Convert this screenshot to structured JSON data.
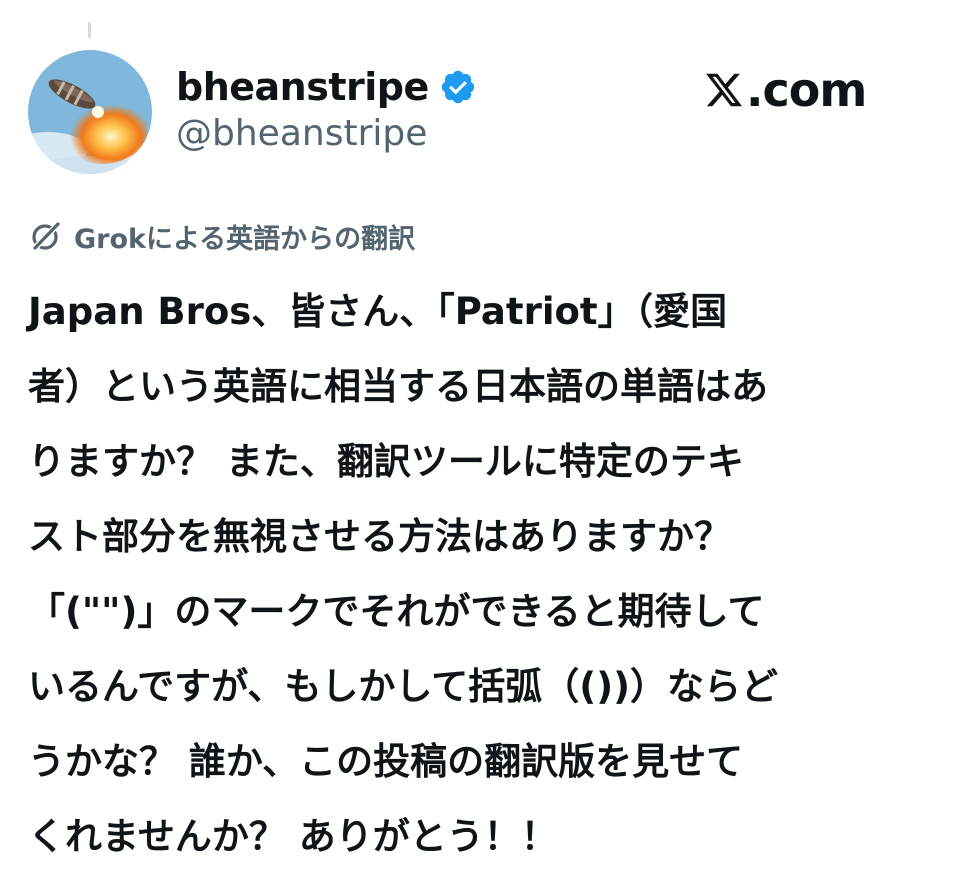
{
  "post": {
    "author": {
      "display_name": "bheanstripe",
      "handle": "@bheanstripe",
      "verified_icon": "verified-badge-icon",
      "avatar": "avatar-image"
    },
    "brand": {
      "text": ".com",
      "icon": "x-logo-icon"
    },
    "translation": {
      "icon": "grok-icon",
      "label": "Grokによる英語からの翻訳"
    },
    "text_lines": [
      "Japan Bros、皆さん、「Patriot」（愛国",
      "者）という英語に相当する日本語の単語はあ",
      "りますか？ また、翻訳ツールに特定のテキ",
      "スト部分を無視させる方法はありますか？",
      "「(\"\")」のマークでそれができると期待して",
      "いるんですが、もしかして括弧（())）ならど",
      "うかな？ 誰か、この投稿の翻訳版を見せて",
      "くれませんか？ ありがとう！！"
    ]
  },
  "colors": {
    "text": "#0f1419",
    "secondary": "#536471",
    "verified": "#1d9bf0",
    "background": "#ffffff"
  }
}
